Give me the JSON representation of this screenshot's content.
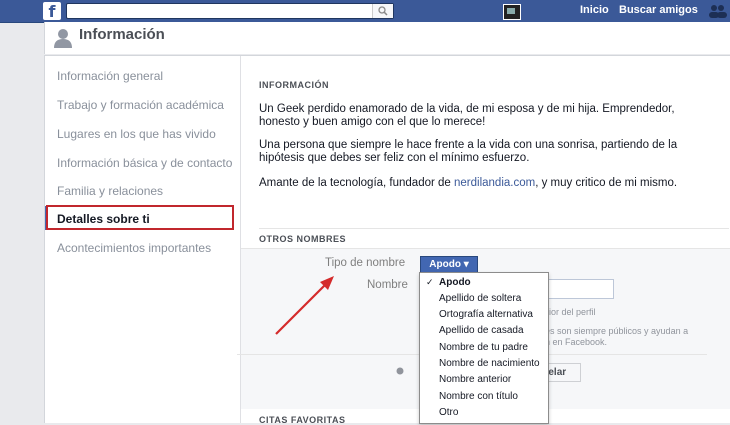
{
  "topbar": {
    "logo": "f",
    "search_placeholder": "",
    "home_label": "Inicio",
    "find_friends_label": "Buscar amigos",
    "colors": {
      "bar": "#3b5998"
    }
  },
  "header": {
    "title": "Información"
  },
  "sidebar": {
    "items": [
      {
        "label": "Información general"
      },
      {
        "label": "Trabajo y formación académica"
      },
      {
        "label": "Lugares en los que has vivido"
      },
      {
        "label": "Información básica y de contacto"
      },
      {
        "label": "Familia y relaciones"
      },
      {
        "label": "Detalles sobre ti",
        "active": true
      },
      {
        "label": "Acontecimientos importantes"
      }
    ]
  },
  "content": {
    "info_title": "INFORMACIÓN",
    "para1": "Un Geek perdido enamorado de la vida, de mi esposa y de mi hija. Emprendedor, honesto y buen amigo con el que lo merece!",
    "para2": "Una persona que siempre le hace frente a la vida con una sonrisa, partiendo de la hipótesis que debes ser feliz con el mínimo esfuerzo.",
    "para3_a": "Amante de la tecnología, fundador de ",
    "para3_link": "nerdilandia.com",
    "para3_b": ", y muy critico de mi mismo.",
    "other_names_title": "OTROS NOMBRES",
    "name_type_label": "Tipo de nombre",
    "name_label": "Nombre",
    "selected_type": "Apodo",
    "hint1": "ior del perfil",
    "hint2a": "es son siempre públicos y ayudan a",
    "hint2b": "n en Facebook.",
    "cancel_label": "celar",
    "quotes_title": "CITAS FAVORITAS"
  },
  "dropdown": {
    "options": [
      {
        "label": "Apodo",
        "selected": true
      },
      {
        "label": "Apellido de soltera"
      },
      {
        "label": "Ortografía alternativa"
      },
      {
        "label": "Apellido de casada"
      },
      {
        "label": "Nombre de tu padre"
      },
      {
        "label": "Nombre de nacimiento"
      },
      {
        "label": "Nombre anterior"
      },
      {
        "label": "Nombre con título"
      },
      {
        "label": "Otro"
      }
    ]
  }
}
